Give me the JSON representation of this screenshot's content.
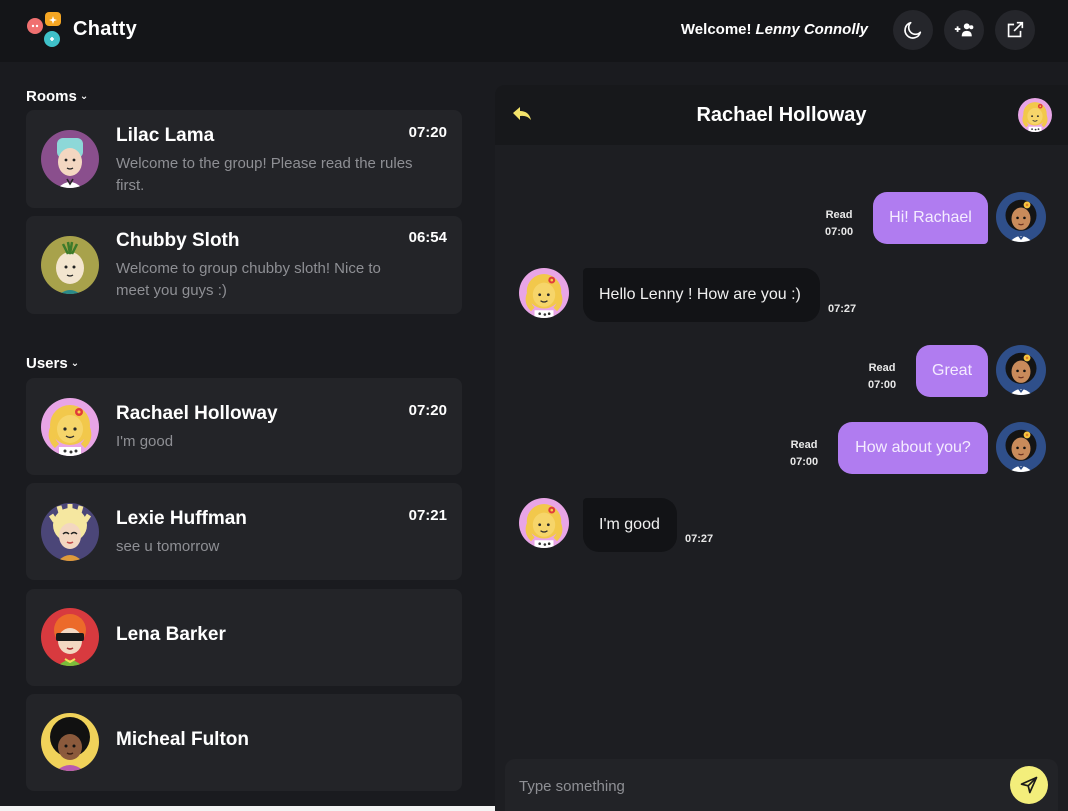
{
  "app": {
    "title": "Chatty"
  },
  "header": {
    "welcome_label": "Welcome!",
    "user_name": "Lenny Connolly",
    "icons": [
      "moon-icon",
      "add-users-icon",
      "external-link-icon"
    ]
  },
  "rooms": {
    "label": "Rooms",
    "items": [
      {
        "name": "Lilac Lama",
        "time": "07:20",
        "message": "Welcome to the group! Please read the rules first."
      },
      {
        "name": "Chubby Sloth",
        "time": "06:54",
        "message": "Welcome to group chubby sloth! Nice to meet you guys :)"
      }
    ]
  },
  "users": {
    "label": "Users",
    "items": [
      {
        "name": "Rachael Holloway",
        "time": "07:20",
        "message": "I'm good"
      },
      {
        "name": "Lexie Huffman",
        "time": "07:21",
        "message": "see u tomorrow"
      },
      {
        "name": "Lena Barker",
        "time": "",
        "message": ""
      },
      {
        "name": "Micheal Fulton",
        "time": "",
        "message": ""
      }
    ]
  },
  "chat": {
    "title": "Rachael Holloway",
    "messages": [
      {
        "dir": "out",
        "text": "Hi! Rachael",
        "status": "Read",
        "time": "07:00"
      },
      {
        "dir": "in",
        "text": "Hello Lenny ! How are you :)",
        "time": "07:27"
      },
      {
        "dir": "out",
        "text": "Great",
        "status": "Read",
        "time": "07:00"
      },
      {
        "dir": "out",
        "text": "How about you?",
        "status": "Read",
        "time": "07:00"
      },
      {
        "dir": "in",
        "text": "I'm good",
        "time": "07:27"
      }
    ],
    "input_placeholder": "Type something"
  },
  "colors": {
    "accent": "#b07cf0",
    "send": "#f3ee7b",
    "background": "#1a1b1f",
    "card": "#232428"
  }
}
